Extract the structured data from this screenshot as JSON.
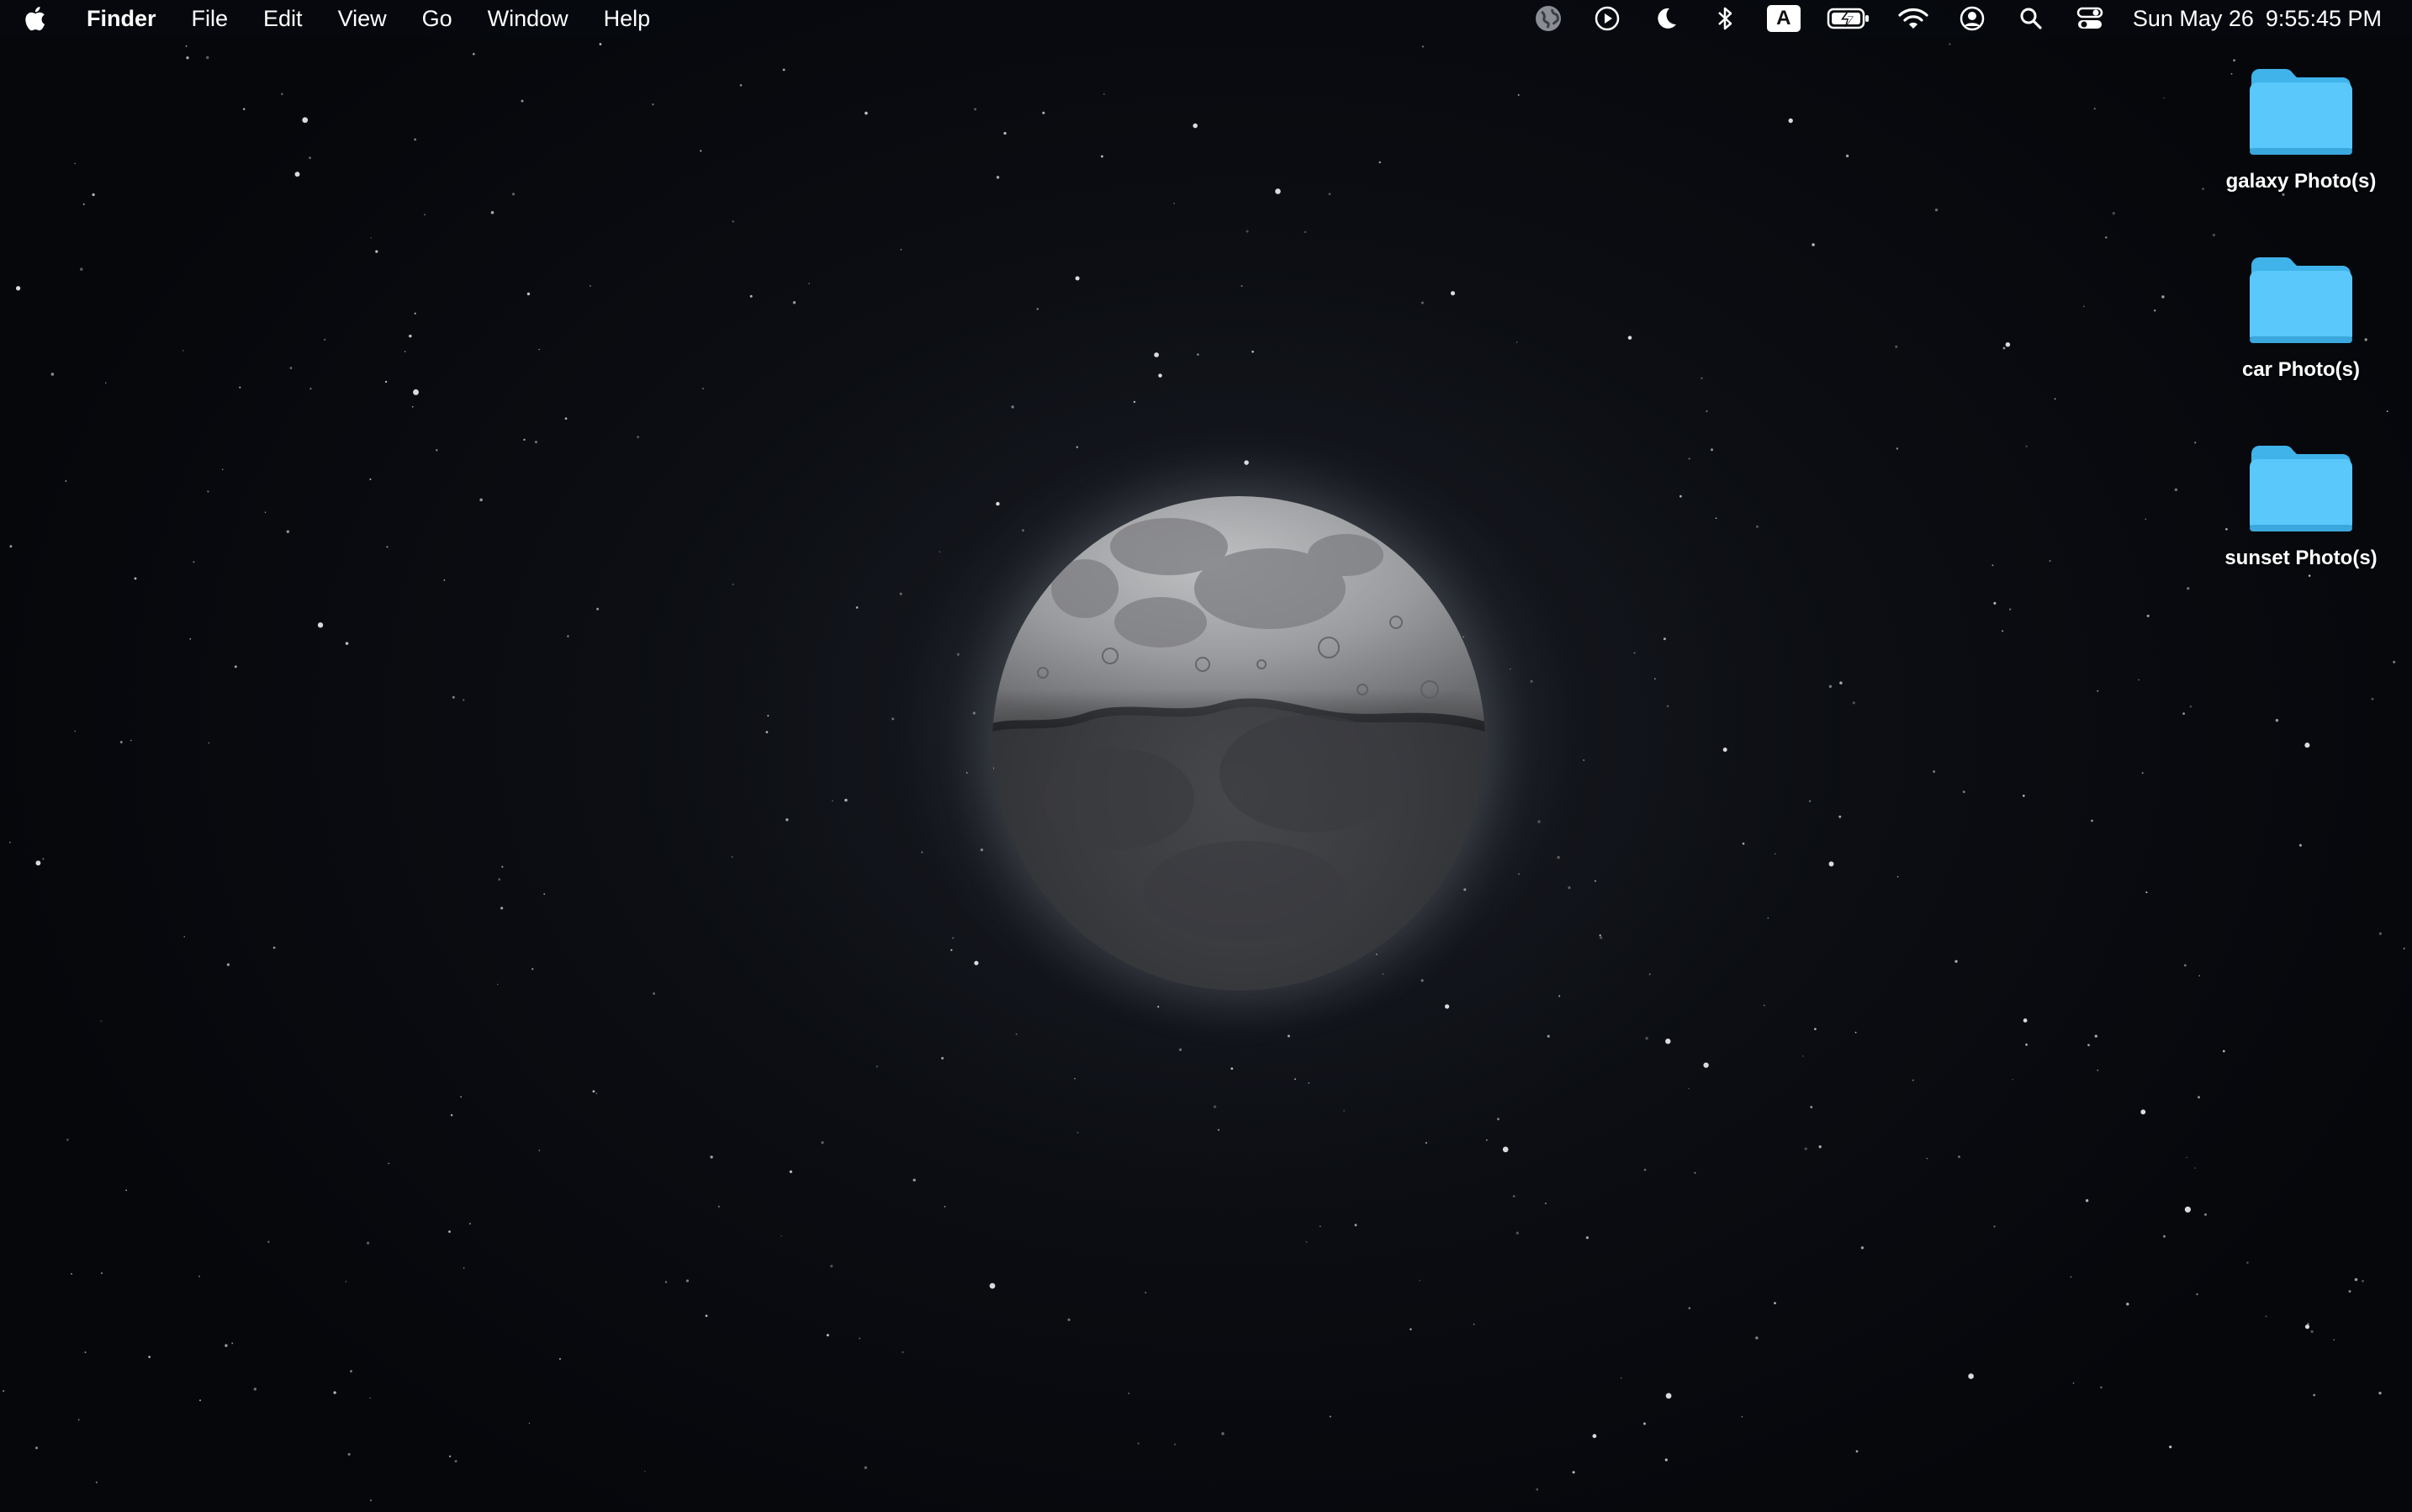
{
  "menubar": {
    "apple_icon": "apple-logo-icon",
    "app_name": "Finder",
    "menus": [
      "File",
      "Edit",
      "View",
      "Go",
      "Window",
      "Help"
    ],
    "status_icons": [
      "globe-icon",
      "play-circle-icon",
      "moon-focus-icon",
      "bluetooth-icon",
      "input-source-icon",
      "battery-charging-icon",
      "wifi-icon",
      "user-account-icon",
      "spotlight-search-icon",
      "control-center-icon"
    ],
    "input_source_label": "A",
    "date": "Sun May 26",
    "time": "9:55:45 PM"
  },
  "desktop": {
    "wallpaper": "moon-over-starfield",
    "folder_color": "#5ac8fa",
    "icons": [
      {
        "label": "galaxy Photo(s)",
        "icon": "folder-icon"
      },
      {
        "label": "car Photo(s)",
        "icon": "folder-icon"
      },
      {
        "label": "sunset Photo(s)",
        "icon": "folder-icon"
      }
    ]
  }
}
